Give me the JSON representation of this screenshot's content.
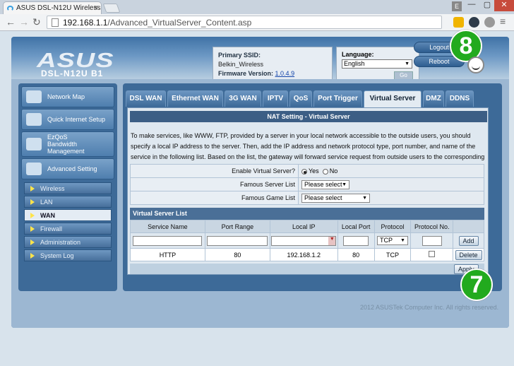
{
  "browser": {
    "tab_title": "ASUS DSL-N12U Wireless",
    "url_host": "192.168.1.1",
    "url_path": "/Advanced_VirtualServer_Content.asp",
    "user_badge": "E"
  },
  "router": {
    "logo": "ASUS",
    "model": "DSL-N12U B1",
    "primary_ssid_label": "Primary SSID:",
    "primary_ssid": "Belkin_Wireless",
    "firmware_label": "Firmware Version:",
    "firmware_version": "1.0.4.9",
    "language_label": "Language:",
    "language_value": "English",
    "language_go": "Go",
    "logout_label": "Logout",
    "reboot_label": "Reboot"
  },
  "sidebar": {
    "main": [
      {
        "label": "Network Map",
        "icon": "network-icon"
      },
      {
        "label": "Quick Internet Setup",
        "icon": "router-icon"
      },
      {
        "label": "EzQoS",
        "label2": "Bandwidth",
        "label3": "Management",
        "icon": "qos-icon"
      },
      {
        "label": "Advanced Setting",
        "icon": "tools-icon"
      }
    ],
    "sub": [
      "Wireless",
      "LAN",
      "WAN",
      "Firewall",
      "Administration",
      "System Log"
    ],
    "selected": "WAN"
  },
  "tabs": [
    "DSL WAN",
    "Ethernet WAN",
    "3G WAN",
    "IPTV",
    "QoS",
    "Port Trigger",
    "Virtual Server",
    "DMZ",
    "DDNS"
  ],
  "selected_tab": "Virtual Server",
  "content": {
    "title": "NAT Setting - Virtual Server",
    "description": "To make services, like WWW, FTP, provided by a server in your local network accessible to the outside users, you should specify a local IP address to the server. Then, add the IP address and network protocol type, port number, and name of the service in the following list. Based on the list, the gateway will forward service request from outside users to the corresponding local server.",
    "enable_label": "Enable Virtual Server?",
    "yes_label": "Yes",
    "no_label": "No",
    "enable_value": "Yes",
    "famous_server_label": "Famous Server List",
    "famous_server_value": "Please select",
    "famous_game_label": "Famous Game List",
    "famous_game_value": "Please select",
    "list_title": "Virtual Server List",
    "columns": [
      "Service Name",
      "Port Range",
      "Local IP",
      "Local Port",
      "Protocol",
      "Protocol No."
    ],
    "new_protocol": "TCP",
    "add_label": "Add",
    "rows": [
      {
        "service": "HTTP",
        "port_range": "80",
        "local_ip": "192.168.1.2",
        "local_port": "80",
        "protocol": "TCP",
        "protocol_no": ""
      }
    ],
    "delete_label": "Delete",
    "apply_label": "Apply"
  },
  "footer": "2012 ASUSTek Computer Inc. All rights reserved.",
  "callouts": [
    "8",
    "7"
  ],
  "colors": {
    "callout": "#22aa1e",
    "header_blue": "#3f72a6",
    "tab_selected": "#e3ebf2"
  }
}
